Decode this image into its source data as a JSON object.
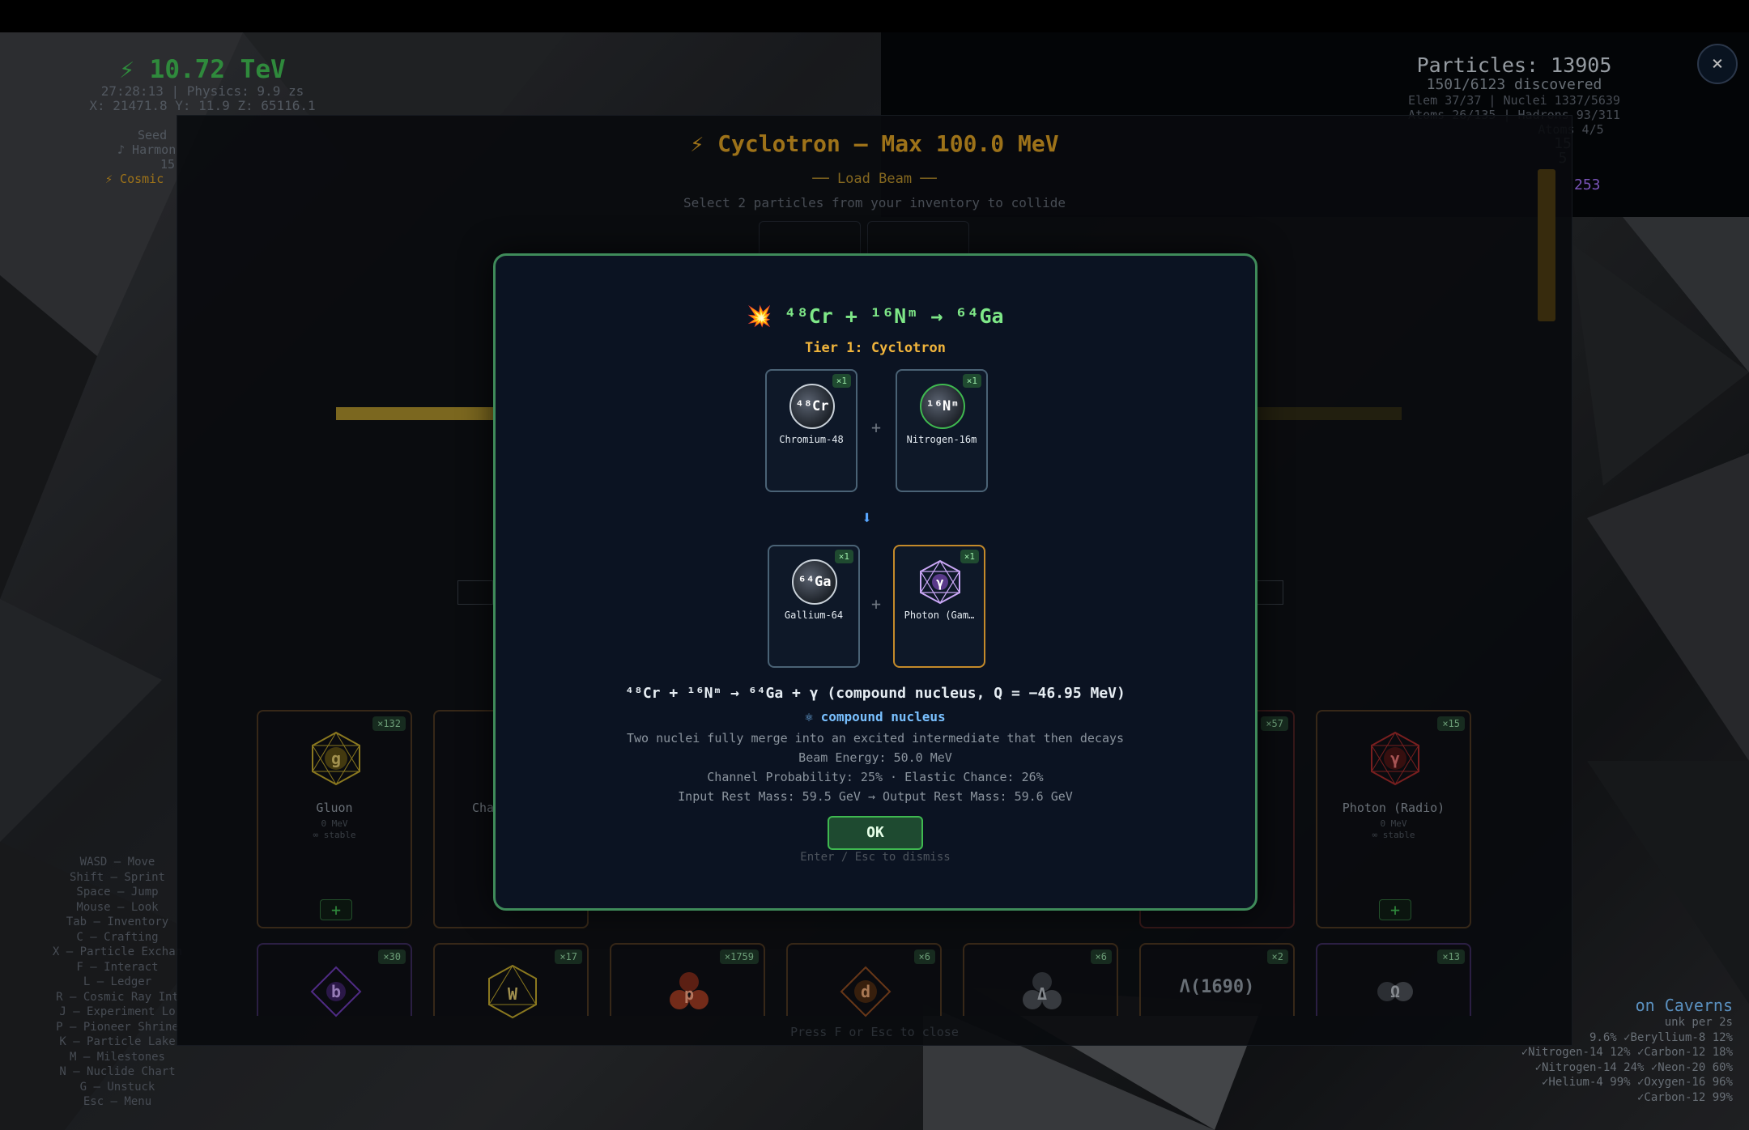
{
  "hud": {
    "energy": "⚡ 10.72 TeV",
    "time_physics": "27:28:13 | Physics: 9.9 zs",
    "coords": "X: 21471.8  Y: 11.9  Z: 65116.1",
    "side_items": [
      "Seed",
      "♪ Harmon",
      "15",
      "⚡ Cosmic"
    ],
    "particles": "Particles: 13905",
    "discovered": "1501/6123 discovered",
    "elements_nuclei": "Elem 37/37 | Nuclei 1337/5639",
    "atoms_hadrons": "Atoms 26/135 | Hadrons 93/311",
    "extra_line": "Atoms 4/5",
    "count_15": "15",
    "count_5": "5",
    "count_253": "253"
  },
  "close_button": "×",
  "controls": [
    "WASD – Move",
    "Shift – Sprint",
    "Space – Jump",
    "Mouse – Look",
    "Tab – Inventory",
    "C – Crafting",
    "X – Particle Exchan",
    "F – Interact",
    "L – Ledger",
    "R – Cosmic Ray Int",
    "J – Experiment Lo",
    "P – Pioneer Shrine",
    "K – Particle Lake",
    "M – Milestones",
    "N – Nuclide Chart",
    "G – Unstuck",
    "Esc – Menu"
  ],
  "caverns": {
    "title": "on Caverns",
    "sub": "unk per 2s",
    "lines": [
      "9.6%  ✓Beryllium-8 12%",
      "✓Nitrogen-14 12%  ✓Carbon-12 18%",
      "✓Nitrogen-14 24%  ✓Neon-20 60%",
      "✓Helium-4 99%  ✓Oxygen-16 96%",
      "✓Carbon-12 99%"
    ]
  },
  "cyclotron": {
    "title": "⚡ Cyclotron — Max 100.0 MeV",
    "load_beam": "── Load Beam ──",
    "hint": "Select 2 particles from your inventory to collide",
    "footer": "Press F or Esc to close",
    "inventory_row1": [
      {
        "name": "Gluon",
        "count": "×132",
        "meta1": "0 MeV",
        "meta2": "∞ stable",
        "symbol": "g",
        "color": "#b8a02a"
      },
      {
        "name": "Cha",
        "count": "",
        "meta1": "",
        "meta2": "",
        "symbol": "",
        "color": "#8a5a20"
      },
      {
        "name": "",
        "count": "×57",
        "meta1": "",
        "meta2": "",
        "symbol": "",
        "color": "#8a2a2a"
      },
      {
        "name": "Photon (Radio)",
        "count": "×15",
        "meta1": "0 MeV",
        "meta2": "∞ stable",
        "symbol": "γ",
        "color": "#a02a2a"
      }
    ],
    "inventory_row2": [
      {
        "count": "×30",
        "symbol": "b",
        "color": "#6a3ab0"
      },
      {
        "count": "×17",
        "symbol": "W",
        "color": "#b8a02a"
      },
      {
        "count": "×1759",
        "symbol": "p",
        "color": "#b04a2a"
      },
      {
        "count": "×6",
        "symbol": "d",
        "color": "#8a4a20"
      },
      {
        "count": "×6",
        "symbol": "Δ",
        "color": "#6e7681"
      },
      {
        "count": "×2",
        "symbol": "Λ(1690)",
        "color": "#8b949e"
      },
      {
        "count": "×13",
        "symbol": "Ω",
        "color": "#8b949e"
      }
    ]
  },
  "modal": {
    "title": "⁴⁸Cr + ¹⁶Nᵐ → ⁶⁴Ga",
    "blast": "💥",
    "tier": "Tier 1: Cyclotron",
    "inputs": [
      {
        "name": "Chromium-48",
        "count": "×1",
        "symbol": "⁴⁸Cr"
      },
      {
        "name": "Nitrogen-16m",
        "count": "×1",
        "symbol": "¹⁶Nᵐ"
      }
    ],
    "arrow": "⬇",
    "outputs": [
      {
        "name": "Gallium-64",
        "count": "×1",
        "symbol": "⁶⁴Ga"
      },
      {
        "name": "Photon (Gam…",
        "count": "×1",
        "symbol": "γ"
      }
    ],
    "plus": "+",
    "equation": "⁴⁸Cr + ¹⁶Nᵐ → ⁶⁴Ga + γ  (compound nucleus, Q = −46.95 MeV)",
    "kind": "⚛ compound nucleus",
    "description": "Two nuclei fully merge into an excited intermediate that then decays",
    "beam_energy": "Beam Energy: 50.0 MeV",
    "probabilities": "Channel Probability: 25%  ·  Elastic Chance: 26%",
    "masses": "Input Rest Mass: 59.5 GeV  →  Output Rest Mass: 59.6 GeV",
    "ok": "OK",
    "dismiss": "Enter / Esc to dismiss"
  },
  "colors": {
    "accent_green": "#3fb950",
    "gold": "#d29922",
    "modal_border": "#3f8b5a",
    "blue": "#79c0ff"
  }
}
